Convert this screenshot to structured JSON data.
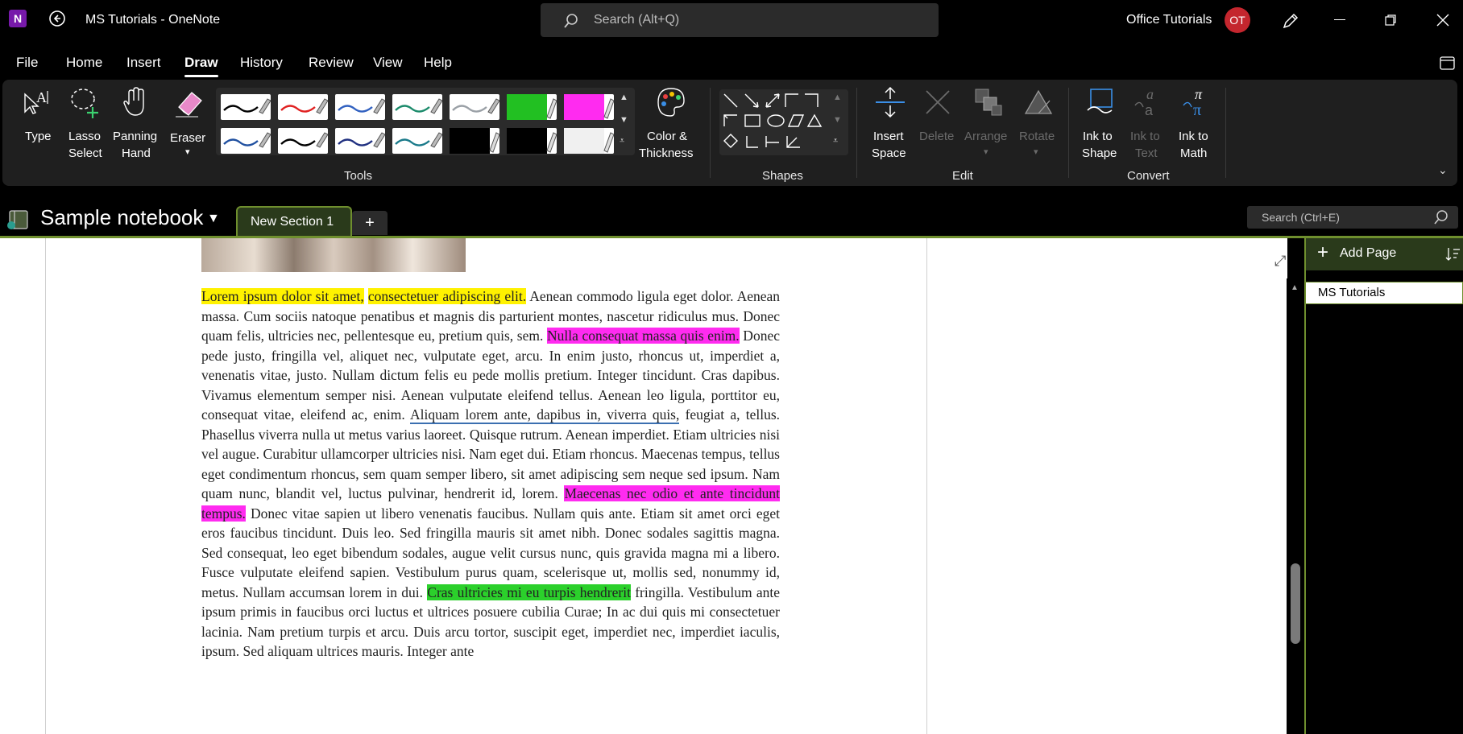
{
  "titlebar": {
    "window_title": "MS Tutorials - OneNote",
    "search_placeholder": "Search (Alt+Q)",
    "account_name": "Office Tutorials",
    "avatar_initials": "OT"
  },
  "menubar": {
    "items": [
      "File",
      "Home",
      "Insert",
      "Draw",
      "History",
      "Review",
      "View",
      "Help"
    ],
    "active": "Draw"
  },
  "ribbon": {
    "tools": {
      "type_label": "Type",
      "lasso_label_1": "Lasso",
      "lasso_label_2": "Select",
      "panning_label_1": "Panning",
      "panning_label_2": "Hand",
      "eraser_label": "Eraser",
      "color_label_1": "Color &",
      "color_label_2": "Thickness",
      "group_label": "Tools"
    },
    "shapes": {
      "group_label": "Shapes"
    },
    "edit": {
      "insert_space_1": "Insert",
      "insert_space_2": "Space",
      "delete": "Delete",
      "arrange": "Arrange",
      "rotate": "Rotate",
      "group_label": "Edit"
    },
    "convert": {
      "ink_to_shape_1": "Ink to",
      "ink_to_shape_2": "Shape",
      "ink_to_text_1": "Ink to",
      "ink_to_text_2": "Text",
      "ink_to_math_1": "Ink to",
      "ink_to_math_2": "Math",
      "group_label": "Convert"
    },
    "pen_colors_row1": [
      "#000000",
      "#e02020",
      "#3060c0",
      "#1a8a6a",
      "#9aa0a6",
      "#22c022",
      "#ff2bf0"
    ],
    "pen_colors_row2": [
      "#2050a0",
      "#000000",
      "#203080",
      "#1a7a8a",
      "#000000",
      "#000000",
      "#f0f0f0"
    ]
  },
  "notebook": {
    "name": "Sample notebook",
    "section_tab": "New Section 1",
    "add_tab": "+",
    "search_placeholder": "Search (Ctrl+E)"
  },
  "pages_pane": {
    "add_page": "Add Page",
    "pages": [
      "MS Tutorials"
    ]
  },
  "content": {
    "hl1": "Lorem ipsum dolor sit amet,",
    "hl2": "consectetuer adipiscing elit.",
    "t1": " Aenean commodo ligula eget dolor. Aenean massa. Cum sociis natoque penatibus et magnis dis parturient montes, nascetur ridiculus mus. Donec quam felis, ultricies nec, pellentesque eu, pretium quis, sem. ",
    "hl3": "Nulla consequat massa quis enim.",
    "t2": " Donec pede justo, fringilla vel, aliquet nec, vulputate eget, arcu. In enim justo, rhoncus ut, imperdiet a, venenatis vitae, justo. Nullam dictum felis eu pede mollis pretium. Integer tincidunt. Cras dapibus. Vivamus elementum semper nisi. Aenean vulputate eleifend tellus. Aenean leo ligula, porttitor eu, consequat vitae, eleifend ac, enim. ",
    "ul1": "Aliquam lorem ante, dapibus in, viverra quis,",
    "t3": " feugiat a, tellus. Phasellus viverra nulla ut metus varius laoreet. Quisque rutrum. Aenean imperdiet. Etiam ultricies nisi vel augue. Curabitur ullamcorper ultricies nisi. Nam eget dui. Etiam rhoncus. Maecenas tempus, tellus eget condimentum rhoncus, sem quam semper libero, sit amet adipiscing sem neque sed ipsum. Nam quam nunc, blandit vel, luctus pulvinar, hendrerit id, lorem. ",
    "hl4": "Maecenas nec odio et ante tincidunt tempus.",
    "t4": " Donec vitae sapien ut libero venenatis faucibus. Nullam quis ante. Etiam sit amet orci eget eros faucibus tincidunt. Duis leo. Sed fringilla mauris sit amet nibh. Donec sodales sagittis magna. Sed consequat, leo eget bibendum sodales, augue velit cursus nunc, quis gravida magna mi a libero. Fusce vulputate eleifend sapien. Vestibulum purus quam, scelerisque ut, mollis sed, nonummy id, metus. Nullam accumsan lorem in dui. ",
    "hl5": "Cras ultricies mi eu turpis hendrerit",
    "t5": " fringilla. Vestibulum ante ipsum primis in faucibus orci luctus et ultrices posuere cubilia Curae; In ac dui quis mi consectetuer lacinia. Nam pretium turpis et arcu. Duis arcu tortor, suscipit eget, imperdiet nec, imperdiet iaculis, ipsum. Sed aliquam ultrices mauris. Integer ante"
  },
  "colors": {
    "accent_green": "#6f8f2e",
    "highlight_yellow": "#fff200",
    "highlight_magenta": "#ff2bf0",
    "highlight_green": "#2bd02b"
  },
  "icons": [
    "onenote-logo-icon",
    "back-icon",
    "search-icon",
    "pen-icon",
    "minimize-icon",
    "restore-icon",
    "close-icon",
    "ribbon-toggle-icon",
    "notebook-icon",
    "dropdown-icon",
    "expand-icon",
    "add-icon",
    "sort-icon"
  ]
}
